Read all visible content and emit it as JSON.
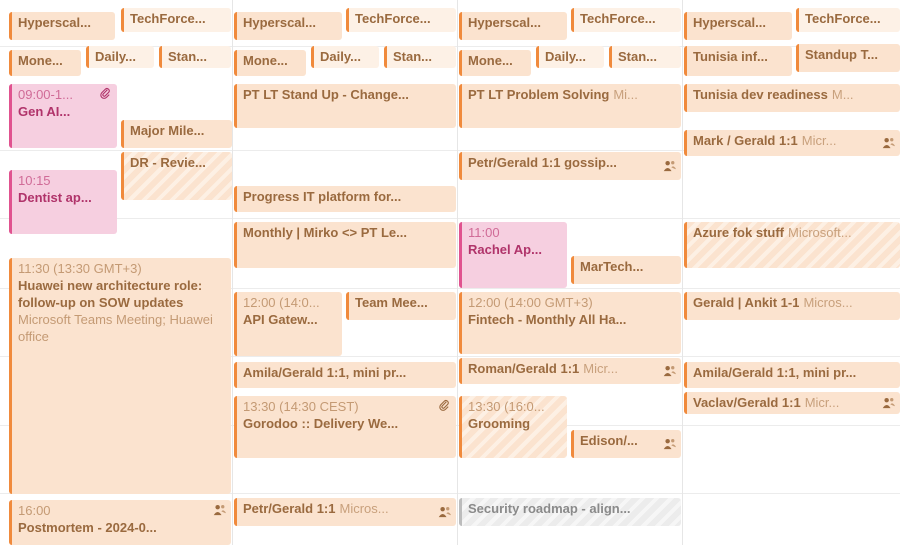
{
  "calendar": {
    "colors": {
      "orange_accent": "#f08a3c",
      "orange_fill": "#fbe3cf",
      "pink_accent": "#e0528f",
      "pink_fill": "#f6cfe0",
      "grey_fill": "#ececec"
    },
    "col1": {
      "ev1": {
        "title": "Hyperscal..."
      },
      "ev2": {
        "title": "TechForce..."
      },
      "ev3": {
        "title": "Mone..."
      },
      "ev4": {
        "title": "Daily..."
      },
      "ev5": {
        "title": "Stan..."
      },
      "ev6": {
        "time": "09:00-1...",
        "title": "Gen AI...",
        "icon": "paperclip-icon"
      },
      "ev7": {
        "title": "Major Mile..."
      },
      "ev8": {
        "title": "DR - Revie..."
      },
      "ev9": {
        "time": "10:15",
        "title": "Dentist ap..."
      },
      "ev10": {
        "time": "11:30 (13:30 GMT+3)",
        "title": "Huawei new architecture role: follow-up on SOW updates",
        "location": "Microsoft Teams Meeting; Huawei office"
      },
      "ev11": {
        "time": "16:00",
        "title": "Postmortem - 2024-0...",
        "icon": "people-icon"
      }
    },
    "col2": {
      "ev1": {
        "title": "Hyperscal..."
      },
      "ev2": {
        "title": "TechForce..."
      },
      "ev3": {
        "title": "Mone..."
      },
      "ev4": {
        "title": "Daily..."
      },
      "ev5": {
        "title": "Stan..."
      },
      "ev6": {
        "title": "PT LT Stand Up - Change..."
      },
      "ev7": {
        "title": "Progress IT platform for..."
      },
      "ev8": {
        "title": "Monthly | Mirko <> PT Le..."
      },
      "ev9": {
        "time": "12:00 (14:0...",
        "title": "API Gatew..."
      },
      "ev10": {
        "title": "Team Mee..."
      },
      "ev11": {
        "title": "Amila/Gerald 1:1, mini pr..."
      },
      "ev12": {
        "time": "13:30 (14:30 CEST)",
        "title": "Gorodoo :: Delivery We...",
        "icon": "paperclip-icon"
      },
      "ev13": {
        "title": "Petr/Gerald 1:1",
        "sub": "Micros...",
        "icon": "people-icon"
      }
    },
    "col3": {
      "ev1": {
        "title": "Hyperscal..."
      },
      "ev2": {
        "title": "TechForce..."
      },
      "ev3": {
        "title": "Mone..."
      },
      "ev4": {
        "title": "Daily..."
      },
      "ev5": {
        "title": "Stan..."
      },
      "ev6": {
        "title": "PT LT Problem Solving",
        "sub": "Mi..."
      },
      "ev7": {
        "title": "Petr/Gerald 1:1 gossip...",
        "icon": "people-icon"
      },
      "ev8": {
        "time": "11:00",
        "title": "Rachel Ap..."
      },
      "ev9": {
        "title": "MarTech..."
      },
      "ev10": {
        "time": "12:00 (14:00 GMT+3)",
        "title": "Fintech - Monthly All Ha..."
      },
      "ev11": {
        "title": "Roman/Gerald 1:1",
        "sub": "Micr...",
        "icon": "people-icon"
      },
      "ev12": {
        "time": "13:30 (16:0...",
        "title": "Grooming"
      },
      "ev13": {
        "title": "Edison/...",
        "icon": "people-icon"
      },
      "ev14": {
        "title": "Security roadmap - align..."
      }
    },
    "col4": {
      "ev1": {
        "title": "Hyperscal..."
      },
      "ev2": {
        "title": "TechForce..."
      },
      "ev3": {
        "title": "Tunisia inf..."
      },
      "ev4": {
        "title": "Standup T..."
      },
      "ev5": {
        "title": "Tunisia dev readiness",
        "sub": "M..."
      },
      "ev6": {
        "title": "Mark / Gerald 1:1",
        "sub": "Micr...",
        "icon": "people-icon"
      },
      "ev7": {
        "title": "Azure fok stuff",
        "sub": "Microsoft..."
      },
      "ev8": {
        "title": "Gerald | Ankit 1-1",
        "sub": "Micros..."
      },
      "ev9": {
        "title": "Amila/Gerald 1:1, mini pr..."
      },
      "ev10": {
        "title": "Vaclav/Gerald 1:1",
        "sub": "Micr...",
        "icon": "people-icon"
      }
    }
  }
}
